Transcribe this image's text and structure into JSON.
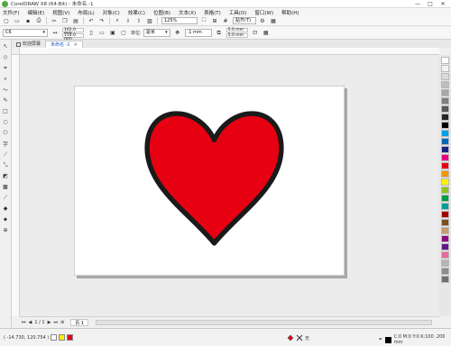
{
  "window": {
    "title": "CorelDRAW X8 (64-Bit) - 未命名 -1",
    "controls": [
      "—",
      "□",
      "✕"
    ]
  },
  "menubar": {
    "items": [
      "文件(F)",
      "编辑(E)",
      "视图(V)",
      "布局(L)",
      "对象(C)",
      "效果(C)",
      "位图(B)",
      "文本(X)",
      "表格(T)",
      "工具(O)",
      "窗口(W)",
      "帮助(H)"
    ]
  },
  "toolbar": {
    "zoom_value": "125%",
    "snap_label": "贴齐(T)"
  },
  "propbar": {
    "preset_value": "C6",
    "width_value": "162.0 mm",
    "height_value": "114.0 mm",
    "units_label": "单位:",
    "units_value": "毫米",
    "nudge_value": ".1 mm",
    "dup_x_value": "5.0 mm",
    "dup_y_value": "5.0 mm"
  },
  "tabs": {
    "welcome": "欢迎屏幕",
    "document": "未命名 -1"
  },
  "page_nav": {
    "page_label": "页 1",
    "counter": "1 / 1"
  },
  "status": {
    "coords": "( -14.730, 120.754 )",
    "fill_none_label": "无",
    "color_info": "C:0 M:0 Y:0 K:100 .200 mm"
  },
  "colors": {
    "heart_fill": "#e60012",
    "heart_outline": "#1a1a1a",
    "page_shadow": "#a8a8a8"
  },
  "palette": [
    "#ffffff",
    "#f2f2f2",
    "#d9d9d9",
    "#bfbfbf",
    "#a6a6a6",
    "#808080",
    "#595959",
    "#262626",
    "#000000",
    "#00a0e9",
    "#0068b7",
    "#1d2088",
    "#e4007f",
    "#e60012",
    "#f39800",
    "#fff100",
    "#8fc31f",
    "#009944",
    "#009e96",
    "#a40000",
    "#7f4f21",
    "#c69c6d",
    "#920783",
    "#601986",
    "#ea68a2",
    "#b5b5b5",
    "#8c8c8c",
    "#6e6e6e"
  ]
}
